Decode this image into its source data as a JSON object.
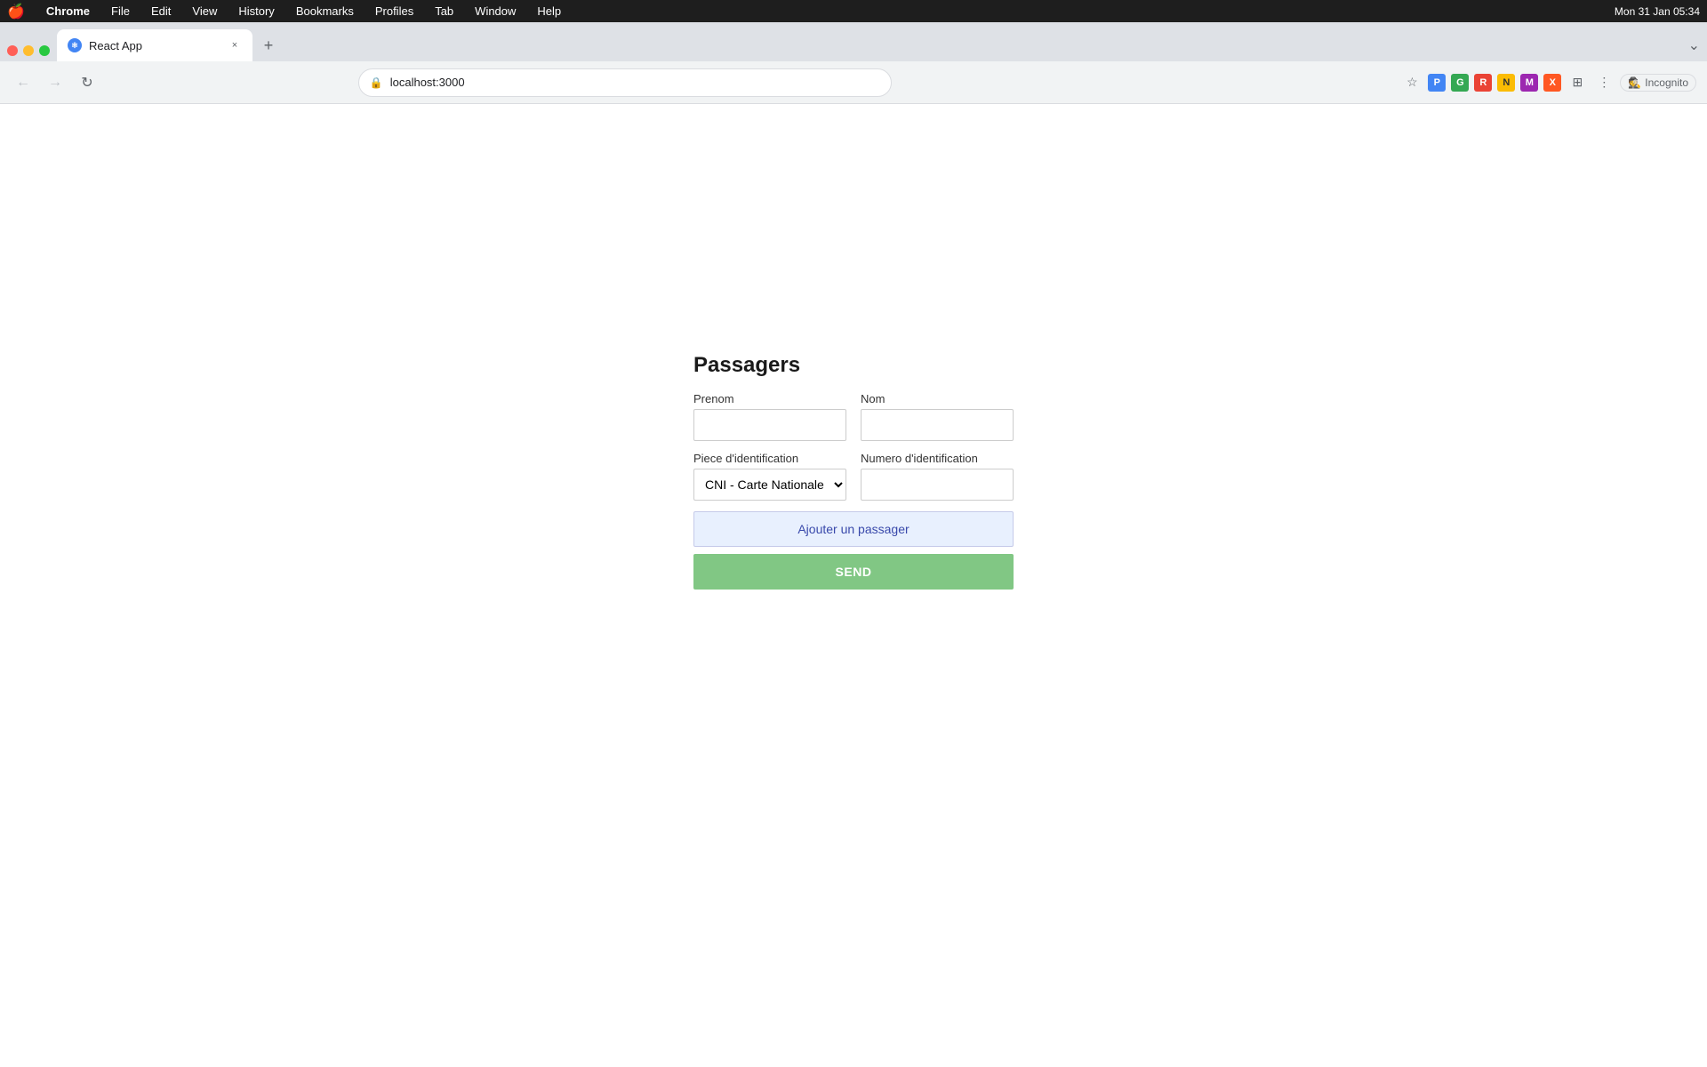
{
  "menubar": {
    "apple": "🍎",
    "items": [
      "Chrome",
      "File",
      "Edit",
      "View",
      "History",
      "Bookmarks",
      "Profiles",
      "Tab",
      "Window",
      "Help"
    ],
    "time": "Mon 31 Jan  05:34"
  },
  "tab": {
    "title": "React App",
    "close_label": "×",
    "new_tab_label": "+"
  },
  "address_bar": {
    "url": "localhost:3000",
    "incognito_label": "Incognito"
  },
  "form": {
    "title": "Passagers",
    "prenom_label": "Prenom",
    "prenom_placeholder": "",
    "nom_label": "Nom",
    "nom_placeholder": "",
    "piece_label": "Piece d'identification",
    "piece_options": [
      "CNI - Carte Nationale d'Ide"
    ],
    "piece_default": "CNI - Carte Nationale d'Ide",
    "numero_label": "Numero d'identification",
    "numero_placeholder": "",
    "add_button_label": "Ajouter un passager",
    "send_button_label": "SEND"
  }
}
